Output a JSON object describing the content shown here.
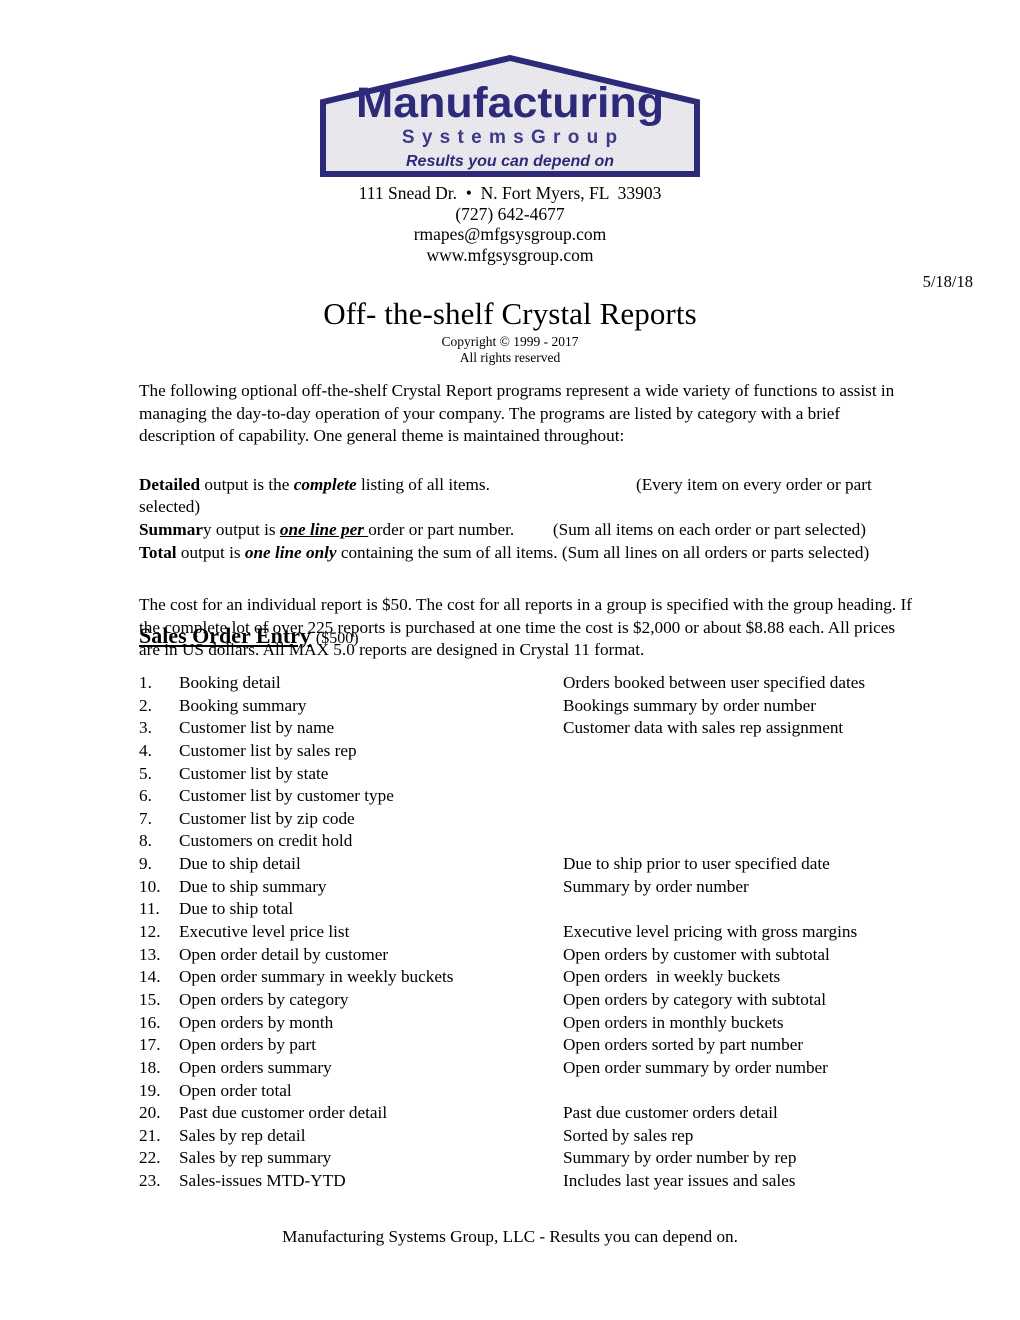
{
  "logo": {
    "company_line1": "Manufacturing",
    "company_line2": "S y s t e m s   G r o u p",
    "tagline": "Results you can depend on",
    "brand_color": "#2d2a7a",
    "fill_color": "#e9e9ec"
  },
  "contact": {
    "address": "111 Snead Dr.  •  N. Fort Myers, FL  33903",
    "phone": "(727) 642-4677",
    "email": "rmapes@mfgsysgroup.com",
    "website": "www.mfgsysgroup.com"
  },
  "date": "5/18/18",
  "title": {
    "heading": "Off- the-shelf Crystal Reports",
    "copyright": "Copyright © 1999 - 2017",
    "rights": "All rights reserved"
  },
  "intro": "The following optional off-the-shelf Crystal Report programs represent a wide variety of functions to assist in managing the day-to-day operation of your company. The programs are listed by category with a brief description of capability. One general theme is maintained throughout:",
  "definitions": [
    {
      "term": "Detailed",
      "mid1": " output is the ",
      "emph": "complete",
      "mid2": " listing of all items.",
      "pad": "                                  ",
      "note": "(Every item on every order or part selected)"
    },
    {
      "term": "Summar",
      "mid1": "y output is ",
      "emph": "one line per ",
      "mid2": "order or part number.",
      "pad": "         ",
      "note": "(Sum all items on each order or part selected)"
    },
    {
      "term": "Total",
      "mid1": " output is ",
      "emph": "one line only",
      "mid2": " containing the sum of all items.",
      "pad": " ",
      "note": "(Sum all lines on all orders or parts selected)"
    }
  ],
  "cost": "The cost for an individual report is $50. The cost for all reports in a group is specified with the group heading. If the complete lot of over 225 reports is purchased at one time the cost is $2,000 or about $8.88 each. All prices are in US dollars. All MAX 5.0 reports are designed in Crystal 11 format.",
  "section": {
    "name": "Sales Order Entry",
    "price": "($500)"
  },
  "reports": [
    {
      "num": "1.",
      "name": "Booking detail",
      "desc": "Orders booked between user specified dates"
    },
    {
      "num": "2.",
      "name": "Booking summary",
      "desc": "Bookings summary by order number"
    },
    {
      "num": "3.",
      "name": "Customer list by name",
      "desc": "Customer data with sales rep assignment"
    },
    {
      "num": "4.",
      "name": "Customer list by sales rep",
      "desc": ""
    },
    {
      "num": "5.",
      "name": "Customer list by state",
      "desc": ""
    },
    {
      "num": "6.",
      "name": "Customer list by customer type",
      "desc": ""
    },
    {
      "num": "7.",
      "name": "Customer list by zip code",
      "desc": ""
    },
    {
      "num": "8.",
      "name": "Customers on credit hold",
      "desc": ""
    },
    {
      "num": "9.",
      "name": "Due to ship detail",
      "desc": "Due to ship prior to user specified date"
    },
    {
      "num": "10.",
      "name": "Due to ship summary",
      "desc": "Summary by order number"
    },
    {
      "num": "11.",
      "name": "Due to ship total",
      "desc": ""
    },
    {
      "num": "12.",
      "name": "Executive level price list",
      "desc": "Executive level pricing with gross margins"
    },
    {
      "num": "13.",
      "name": "Open order detail by customer",
      "desc": "Open orders by customer with subtotal"
    },
    {
      "num": "14.",
      "name": "Open order summary in weekly buckets",
      "desc": "Open orders  in weekly buckets"
    },
    {
      "num": "15.",
      "name": "Open orders by category",
      "desc": "Open orders by category with subtotal"
    },
    {
      "num": "16.",
      "name": "Open orders by month",
      "desc": "Open orders in monthly buckets"
    },
    {
      "num": "17.",
      "name": "Open orders by part",
      "desc": "Open orders sorted by part number"
    },
    {
      "num": "18.",
      "name": "Open orders summary",
      "desc": "Open order summary by order number"
    },
    {
      "num": "19.",
      "name": "Open order total",
      "desc": ""
    },
    {
      "num": "20.",
      "name": "Past due customer order detail",
      "desc": "Past due customer orders detail"
    },
    {
      "num": "21.",
      "name": "Sales by rep detail",
      "desc": "Sorted by sales rep"
    },
    {
      "num": "22.",
      "name": "Sales by rep summary",
      "desc": "Summary by order number by rep"
    },
    {
      "num": "23.",
      "name": "Sales-issues MTD-YTD",
      "desc": "Includes last year issues and sales"
    }
  ],
  "footer": "Manufacturing Systems Group, LLC - Results you can depend on."
}
